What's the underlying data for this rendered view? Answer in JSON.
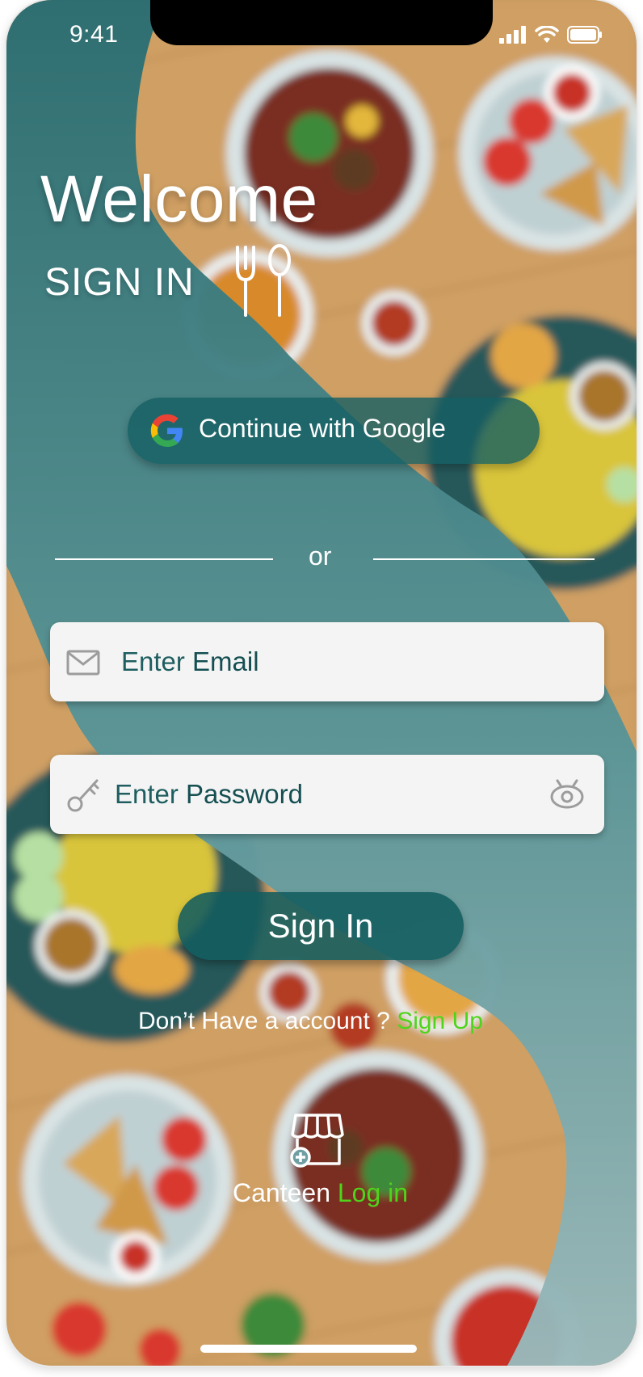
{
  "status_bar": {
    "time": "9:41"
  },
  "header": {
    "welcome": "Welcome",
    "subtitle": "SIGN IN"
  },
  "google_button": {
    "label": "Continue with Google"
  },
  "divider": {
    "text": "or"
  },
  "email_field": {
    "placeholder_prefix": "Enter ",
    "placeholder_main": "Email"
  },
  "password_field": {
    "placeholder_prefix": "Enter ",
    "placeholder_main": "Password"
  },
  "signin_button": {
    "label": "Sign In"
  },
  "signup_prompt": {
    "text": "Don’t Have a account ? ",
    "link": "Sign Up"
  },
  "canteen_login": {
    "text": "Canteen ",
    "link": "Log in"
  },
  "colors": {
    "accent_teal": "#145f63",
    "link_green": "#4fd41c",
    "field_bg": "#f4f4f4"
  },
  "icons": [
    "cutlery-icon",
    "google-icon",
    "mail-icon",
    "key-icon",
    "eye-icon",
    "store-icon"
  ]
}
